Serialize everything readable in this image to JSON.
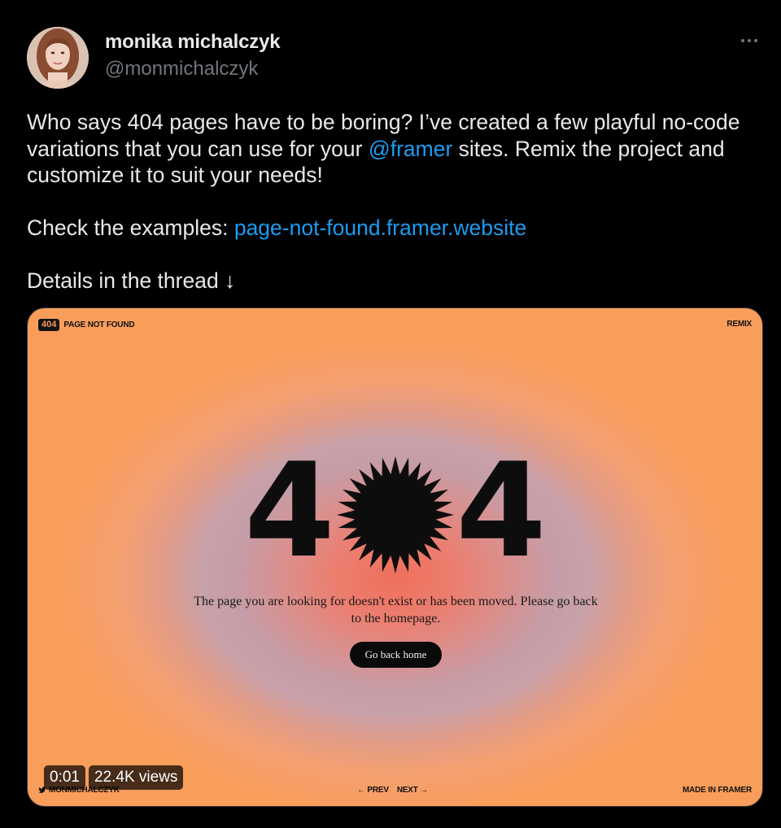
{
  "author": {
    "display_name": "monika michalczyk",
    "handle": "@monmichalczyk"
  },
  "tweet": {
    "para1_part1": "Who says 404 pages have to be boring? I’ve created a few playful no-code variations that you can use for your ",
    "para1_mention": "@framer",
    "para1_part2": " sites. Remix the project and customize it to suit your needs!",
    "para2_prefix": "Check the examples: ",
    "para2_link": "page-not-found.framer.website",
    "para3": "Details in the thread ↓"
  },
  "media": {
    "badge": "404",
    "top_left_label": "PAGE NOT FOUND",
    "top_right_label": "REMIX",
    "big_text_left": "4",
    "big_text_right": "4",
    "message": "The page you are looking for doesn't exist or has been moved. Please go back to the homepage.",
    "button_label": "Go back home",
    "footer_handle": "MONMICHALCZYK",
    "prev_label": "← PREV",
    "next_label": "NEXT →",
    "made_in_label": "MADE IN FRAMER",
    "video_time": "0:01",
    "video_views": "22.4K views"
  },
  "colors": {
    "background": "#000000",
    "text": "#e7e9ea",
    "muted": "#71767b",
    "link": "#1d9bf0",
    "media_orange": "#f99d5b",
    "media_center": "#ef6f5c"
  }
}
